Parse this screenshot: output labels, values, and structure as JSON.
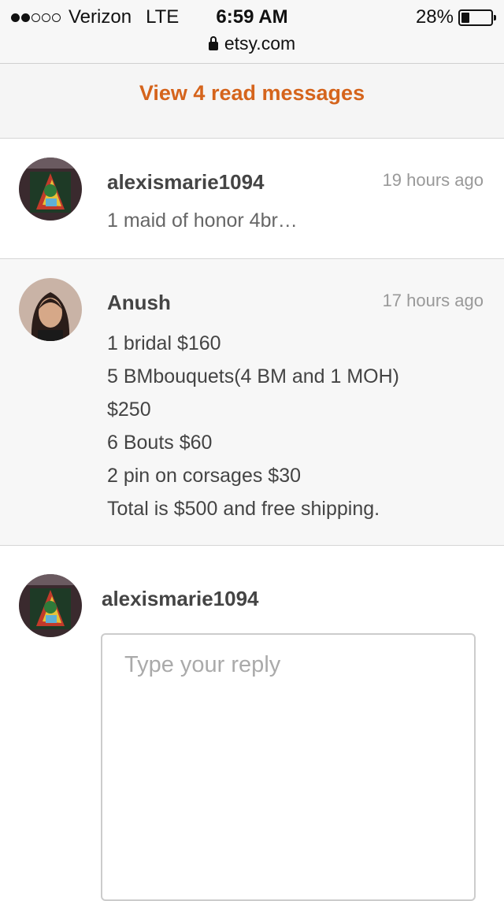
{
  "status_bar": {
    "signal": "●●○○○",
    "carrier": "Verizon",
    "network": "LTE",
    "time": "6:59 AM",
    "battery_percent": "28%",
    "battery_level": 0.28,
    "url": "etsy.com"
  },
  "banner": {
    "link_label": "View 4 read messages"
  },
  "messages": [
    {
      "sender": "alexismarie1094",
      "time": "19 hours ago",
      "preview": "1 maid of honor 4br…"
    },
    {
      "sender": "Anush",
      "time": "17 hours ago",
      "lines": [
        "1 bridal $160",
        "5 BMbouquets(4 BM and 1 MOH)",
        "$250",
        "6 Bouts $60",
        "2 pin on corsages $30",
        "Total is $500 and free shipping."
      ]
    }
  ],
  "reply": {
    "user": "alexismarie1094",
    "placeholder": "Type your reply",
    "value": ""
  },
  "colors": {
    "accent": "#d5641c",
    "divider": "#d6d6d6",
    "banner_bg": "#f5f5f5"
  }
}
